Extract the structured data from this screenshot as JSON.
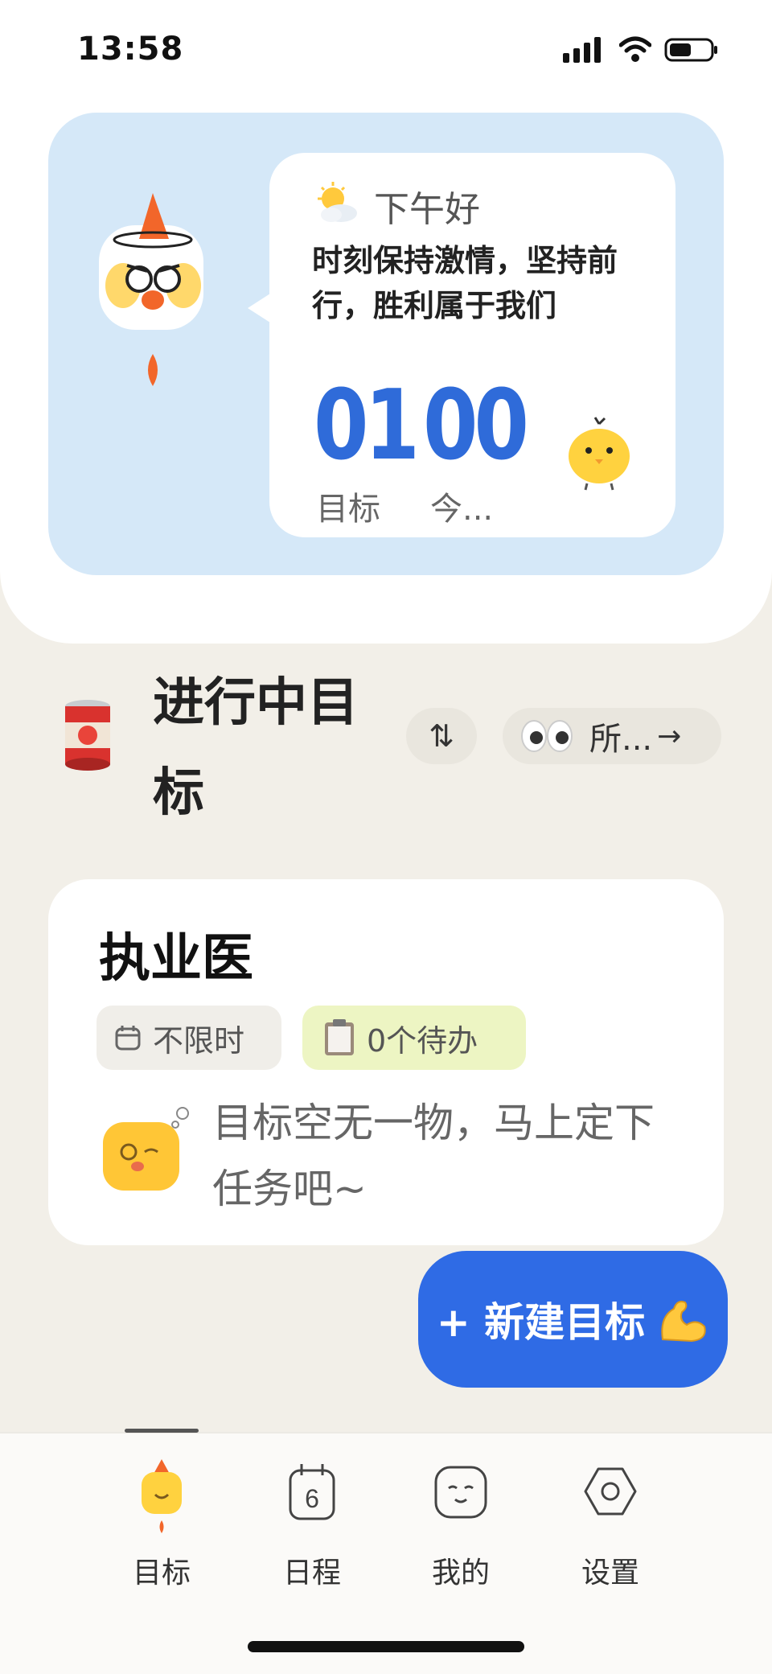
{
  "status_bar": {
    "time": "13:58"
  },
  "hero": {
    "greeting": "下午好",
    "motto": "时刻保持激情，坚持前行，胜利属于我们",
    "stats": [
      {
        "value": "01",
        "label": "目标"
      },
      {
        "value": "00",
        "label": "今..."
      }
    ]
  },
  "section": {
    "title": "进行中目标",
    "filter_label": "所...",
    "filter_arrow": "→",
    "sort_symbol": "⇅"
  },
  "goal": {
    "title": "执业医",
    "tag_time": "不限时",
    "tag_todo": "0个待办",
    "empty_text": "目标空无一物，马上定下任务吧~"
  },
  "fab": {
    "label": "+ 新建目标"
  },
  "tabs": [
    {
      "label": "目标"
    },
    {
      "label": "日程"
    },
    {
      "label": "我的"
    },
    {
      "label": "设置"
    }
  ],
  "colors": {
    "accent": "#2F6BE5",
    "hero_bg": "#D5E8F8",
    "page_bg": "#F2EFE8",
    "todo_tag": "#EDF5C3"
  },
  "icons": [
    "weather-sun-cloud-icon",
    "mascot-icon",
    "chick-icon",
    "can-icon",
    "sort-icon",
    "eyes-icon",
    "calendar-icon",
    "clipboard-icon",
    "sleepy-bun-icon",
    "flexed-arm-icon",
    "tab-goals-icon",
    "tab-schedule-icon",
    "tab-mine-icon",
    "tab-settings-icon"
  ]
}
